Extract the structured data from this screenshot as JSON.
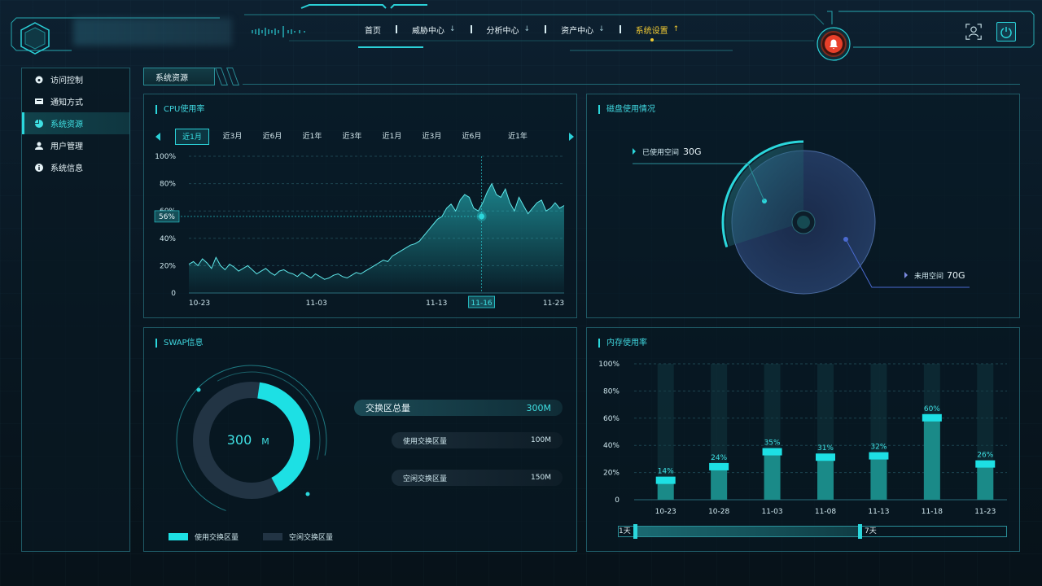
{
  "header": {
    "nav": [
      {
        "label": "首页",
        "chev": false
      },
      {
        "label": "威胁中心",
        "chev": true
      },
      {
        "label": "分析中心",
        "chev": true
      },
      {
        "label": "资产中心",
        "chev": true
      },
      {
        "label": "系统设置",
        "chev": true,
        "active": true
      }
    ]
  },
  "sidebar": {
    "items": [
      {
        "label": "访问控制",
        "icon": "dashboard-icon"
      },
      {
        "label": "通知方式",
        "icon": "message-icon"
      },
      {
        "label": "系统资源",
        "icon": "pie-icon",
        "active": true
      },
      {
        "label": "用户管理",
        "icon": "user-icon"
      },
      {
        "label": "系统信息",
        "icon": "info-icon"
      }
    ]
  },
  "page_tab": "系统资源",
  "cpu": {
    "title": "CPU使用率",
    "tabs": [
      "近1月",
      "近3月",
      "近6月",
      "近1年",
      "近3年",
      "近1月",
      "近3月",
      "近6月",
      "近1年"
    ],
    "highlight_value": "56%",
    "highlight_date": "11-16"
  },
  "disk": {
    "title": "磁盘使用情况",
    "used_label": "已使用空间",
    "used_value": "30G",
    "free_label": "未用空间",
    "free_value": "70G"
  },
  "swap": {
    "title": "SWAP信息",
    "center_value": "300",
    "center_unit": "M",
    "total_label": "交换区总量",
    "total_value": "300M",
    "used_label": "使用交换区量",
    "used_value": "100M",
    "free_label": "空闲交换区量",
    "free_value": "150M",
    "legend_used": "使用交换区量",
    "legend_free": "空闲交换区量"
  },
  "memory": {
    "title": "内存使用率",
    "range_start": "1天",
    "range_end": "7天"
  },
  "colors": {
    "accent": "#2bd7dc",
    "active_nav": "#f0c932",
    "alarm": "#e8402a"
  },
  "chart_data": [
    {
      "type": "area",
      "title": "CPU使用率",
      "x_ticks": [
        "10-23",
        "11-03",
        "11-13",
        "11-16",
        "11-23"
      ],
      "y_ticks": [
        "100%",
        "80%",
        "60%",
        "40%",
        "20%",
        "0"
      ],
      "ylim": [
        0,
        100
      ],
      "grid": true,
      "highlight": {
        "x": "11-16",
        "y": 56
      },
      "values": [
        21,
        23,
        20,
        25,
        22,
        18,
        26,
        20,
        17,
        21,
        19,
        16,
        18,
        20,
        17,
        14,
        16,
        18,
        15,
        13,
        16,
        17,
        15,
        14,
        12,
        15,
        13,
        11,
        14,
        12,
        10,
        11,
        13,
        14,
        12,
        11,
        13,
        15,
        14,
        16,
        18,
        20,
        22,
        24,
        23,
        27,
        29,
        31,
        33,
        35,
        36,
        38,
        42,
        46,
        50,
        54,
        56,
        62,
        65,
        60,
        68,
        72,
        70,
        62,
        60,
        66,
        74,
        80,
        72,
        70,
        76,
        66,
        60,
        70,
        64,
        58,
        62,
        66,
        68,
        60,
        62,
        66,
        62,
        64
      ]
    },
    {
      "type": "pie",
      "title": "磁盘使用情况",
      "slices": [
        {
          "name": "已使用空间",
          "value": 30
        },
        {
          "name": "未用空间",
          "value": 70
        }
      ]
    },
    {
      "type": "pie",
      "title": "SWAP信息",
      "slices": [
        {
          "name": "使用交换区量",
          "value": 100
        },
        {
          "name": "空闲交换区量",
          "value": 150
        }
      ]
    },
    {
      "type": "bar",
      "title": "内存使用率",
      "categories": [
        "10-23",
        "10-28",
        "11-03",
        "11-08",
        "11-13",
        "11-18",
        "11-23"
      ],
      "values": [
        14,
        24,
        35,
        31,
        32,
        60,
        26
      ],
      "y_ticks": [
        "100%",
        "80%",
        "60%",
        "40%",
        "20%",
        "0"
      ],
      "ylim": [
        0,
        100
      ]
    }
  ]
}
